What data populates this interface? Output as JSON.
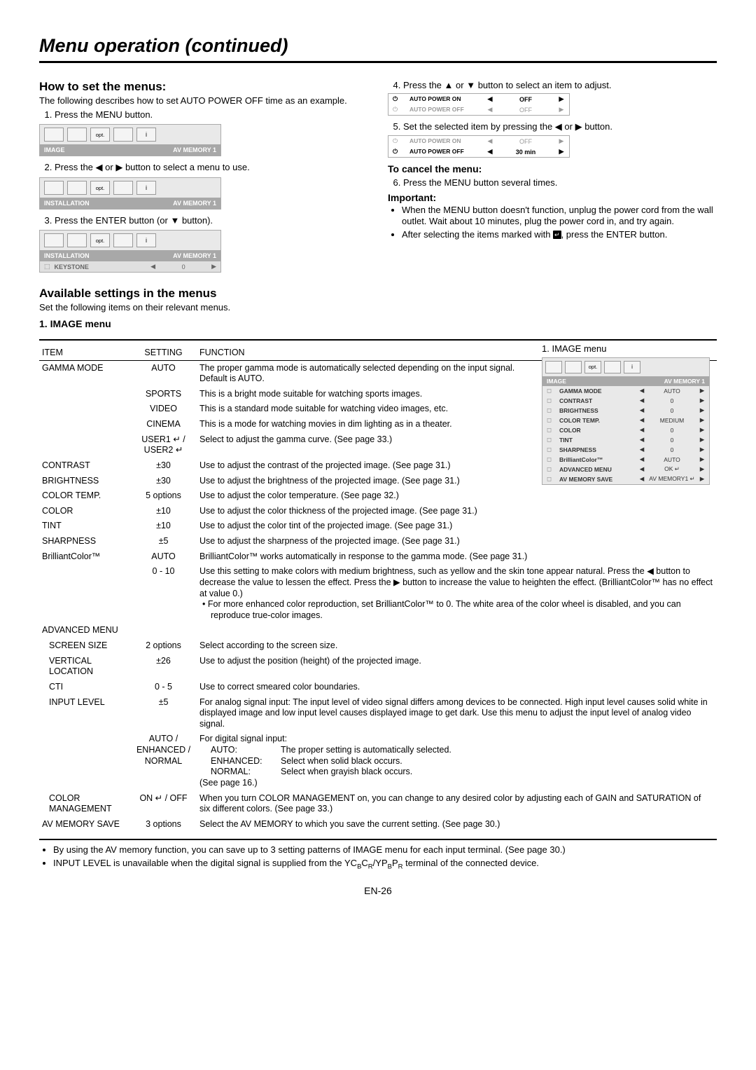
{
  "page": {
    "title": "Menu operation (continued)",
    "number": "EN-26"
  },
  "howto": {
    "heading": "How to set the menus:",
    "intro": "The following describes how to set AUTO POWER OFF time as an example.",
    "step1": "Press the MENU button.",
    "step2_pre": "Press the ",
    "step2_mid": " or ",
    "step2_post": " button to select a menu to use.",
    "step3_pre": "Press the ENTER button (or ",
    "step3_post": " button).",
    "step4_pre": "Press the ",
    "step4_mid": " or ",
    "step4_post": " button to select an item to adjust.",
    "step5_pre": "Set the selected item by pressing the ",
    "step5_mid": " or ",
    "step5_post": " button.",
    "cancel_h": "To cancel the menu:",
    "step6": "Press the MENU button several times.",
    "important_h": "Important:",
    "imp1": "When the MENU button doesn't function, unplug the power cord from the wall outlet. Wait about 10 minutes, plug the power cord in, and try again.",
    "imp2_pre": "After selecting the items marked with ",
    "imp2_post": ", press the ENTER button."
  },
  "menuBoxes": {
    "tabs": [
      "",
      "",
      "opt.",
      "",
      "i"
    ],
    "image_label": "IMAGE",
    "install_label": "INSTALLATION",
    "av_memory": "AV MEMORY 1",
    "keystone": "KEYSTONE",
    "zero": "0",
    "autopower_on": "AUTO POWER ON",
    "autopower_off": "AUTO POWER OFF",
    "off": "OFF",
    "thirty": "30 min"
  },
  "available": {
    "heading": "Available settings in the menus",
    "intro": "Set the following items on their relevant menus.",
    "image_menu_h": "1. IMAGE menu",
    "table_headers": {
      "item": "ITEM",
      "setting": "SETTING",
      "function": "FUNCTION"
    },
    "side_title": "1. IMAGE menu"
  },
  "sideMenu": {
    "header_l": "IMAGE",
    "header_r": "AV MEMORY 1",
    "rows": [
      {
        "name": "GAMMA MODE",
        "val": "AUTO"
      },
      {
        "name": "CONTRAST",
        "val": "0"
      },
      {
        "name": "BRIGHTNESS",
        "val": "0"
      },
      {
        "name": "COLOR TEMP.",
        "val": "MEDIUM"
      },
      {
        "name": "COLOR",
        "val": "0"
      },
      {
        "name": "TINT",
        "val": "0"
      },
      {
        "name": "SHARPNESS",
        "val": "0"
      },
      {
        "name": "BrilliantColor™",
        "val": "AUTO"
      },
      {
        "name": "ADVANCED MENU",
        "val": "OK ↵"
      },
      {
        "name": "AV MEMORY SAVE",
        "val": "AV MEMORY1 ↵"
      }
    ]
  },
  "table": [
    {
      "item": "GAMMA MODE",
      "setting": "AUTO",
      "fn": "The proper gamma mode is automatically selected depending on the input signal. Default is AUTO."
    },
    {
      "item": "",
      "setting": "SPORTS",
      "fn": "This is a bright mode suitable for watching sports images."
    },
    {
      "item": "",
      "setting": "VIDEO",
      "fn": "This is a standard mode suitable for watching video images, etc."
    },
    {
      "item": "",
      "setting": "CINEMA",
      "fn": "This is a mode for watching movies in dim lighting as in a theater."
    },
    {
      "item": "",
      "setting": "USER1 ↵ / USER2 ↵",
      "fn": "Select to adjust the gamma curve. (See page 33.)"
    },
    {
      "item": "CONTRAST",
      "setting": "±30",
      "fn": "Use to adjust the contrast of the projected image. (See page 31.)"
    },
    {
      "item": "BRIGHTNESS",
      "setting": "±30",
      "fn": "Use to adjust the brightness of the projected image. (See page 31.)"
    },
    {
      "item": "COLOR TEMP.",
      "setting": "5 options",
      "fn": "Use to adjust the color temperature. (See page 32.)"
    },
    {
      "item": "COLOR",
      "setting": "±10",
      "fn": "Use to adjust the color thickness of the projected image. (See page 31.)"
    },
    {
      "item": "TINT",
      "setting": "±10",
      "fn": "Use to adjust the color tint of the projected image. (See page 31.)"
    },
    {
      "item": "SHARPNESS",
      "setting": "±5",
      "fn": "Use to adjust the sharpness of the projected image. (See page 31.)"
    },
    {
      "item": "BrilliantColor™",
      "setting": "AUTO",
      "fn": "BrilliantColor™ works automatically in response to the gamma mode. (See page 31.)"
    },
    {
      "item": "",
      "setting": "0 - 10",
      "fn": "Use this setting to make colors with medium brightness, such as yellow and the skin tone appear natural. Press the ◀ button to decrease the value to lessen the effect. Press the ▶ button to increase the value to heighten the effect. (BrilliantColor™ has no effect at value 0.)",
      "extra": "For more enhanced color reproduction, set BrilliantColor™ to 0. The white area of the color wheel is disabled, and you can reproduce true-color images."
    },
    {
      "item": "ADVANCED MENU",
      "setting": "",
      "fn": ""
    },
    {
      "item": "SCREEN SIZE",
      "setting": "2 options",
      "fn": "Select according to the screen size.",
      "indent": true
    },
    {
      "item": "VERTICAL LOCATION",
      "setting": "±26",
      "fn": "Use to adjust the position (height) of the projected image.",
      "indent": true
    },
    {
      "item": "CTI",
      "setting": "0 - 5",
      "fn": "Use to correct smeared color boundaries.",
      "indent": true
    },
    {
      "item": "INPUT LEVEL",
      "setting": "±5",
      "fn": "For analog signal input: The input level of video signal differs among devices to be connected. High input level causes solid white in displayed image and low input level causes displayed image to get dark. Use this menu to adjust the input level of analog video signal.",
      "indent": true
    },
    {
      "item": "",
      "setting": "AUTO / ENHANCED / NORMAL",
      "fn": "For digital signal input:",
      "defs": [
        [
          "AUTO:",
          "The proper setting is automatically selected."
        ],
        [
          "ENHANCED:",
          "Select when solid black occurs."
        ],
        [
          "NORMAL:",
          "Select when grayish black occurs."
        ]
      ],
      "after": "(See page 16.)",
      "indent": true
    },
    {
      "item": "COLOR MANAGEMENT",
      "setting": "ON ↵ / OFF",
      "fn": "When you turn COLOR MANAGEMENT on, you can change to any desired color by adjusting each of GAIN and SATURATION of six different colors. (See page 33.)",
      "indent": true
    },
    {
      "item": "AV MEMORY SAVE",
      "setting": "3 options",
      "fn": "Select the AV MEMORY to which you save the current setting. (See page 30.)"
    }
  ],
  "footnotes": {
    "n1": "By using the AV memory function, you can save up to 3 setting patterns of IMAGE menu for each input terminal. (See page 30.)",
    "n2_pre": "INPUT LEVEL is unavailable when the digital signal is supplied from the YC",
    "n2_mid1": "B",
    "n2_mid2": "C",
    "n2_mid3": "R",
    "n2_mid4": "/YP",
    "n2_mid5": "B",
    "n2_mid6": "P",
    "n2_mid7": "R",
    "n2_post": " terminal of the connected device."
  }
}
